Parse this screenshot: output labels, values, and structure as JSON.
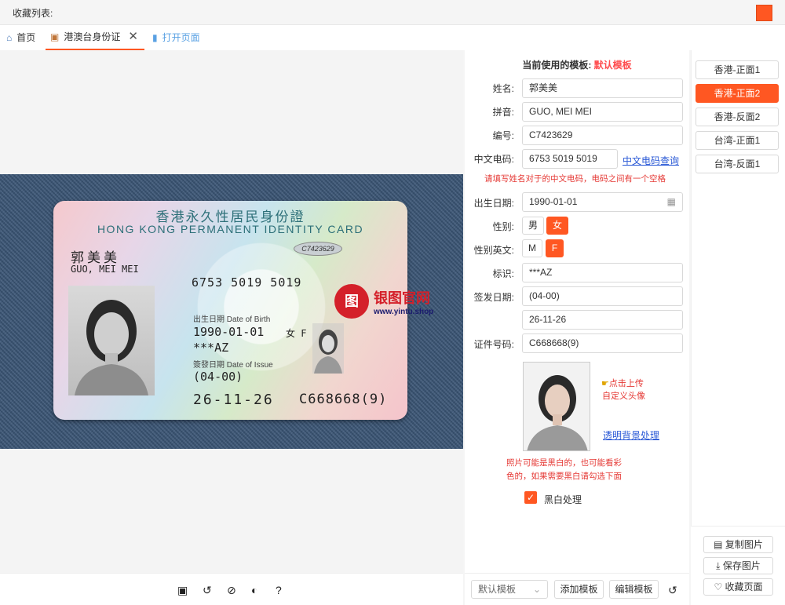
{
  "topbar": {
    "title": "收藏列表:",
    "accent": "#ff5722"
  },
  "tabs": [
    {
      "label": "首页",
      "icon": "home-icon"
    },
    {
      "label": "港澳台身份证",
      "icon": "id-card-icon"
    },
    {
      "label": "打开页面",
      "icon": "page-icon"
    }
  ],
  "card": {
    "title_zh": "香港永久性居民身份證",
    "title_en": "HONG KONG PERMANENT IDENTITY CARD",
    "chip": "C7423629",
    "name_zh": "郭美美",
    "name_en": "GUO, MEI MEI",
    "ccode": "6753 5019 5019",
    "dob_label": "出生日期 Date of Birth",
    "dob": "1990-01-01",
    "sex": "女 F",
    "mark": "***AZ",
    "issue_label": "簽發日期 Date of Issue",
    "issue1": "(04-00)",
    "issue2": "26-11-26",
    "id_no": "C668668(9)"
  },
  "watermark": {
    "logo": "图",
    "name": "银图官网",
    "url": "www.yintu.shop"
  },
  "form": {
    "header_label": "当前使用的模板:",
    "header_value": "默认模板",
    "name_label": "姓名:",
    "name": "郭美美",
    "pinyin_label": "拼音:",
    "pinyin": "GUO, MEI MEI",
    "no_label": "编号:",
    "no": "C7423629",
    "ccode_label": "中文电码:",
    "ccode": "6753 5019 5019",
    "ccode_link": "中文电码查询",
    "ccode_hint": "请填写姓名对于的中文电码，电码之间有一个空格",
    "dob_label": "出生日期:",
    "dob": "1990-01-01",
    "sex_label": "性别:",
    "sex_m": "男",
    "sex_f": "女",
    "sexen_label": "性别英文:",
    "sexen_m": "M",
    "sexen_f": "F",
    "mark_label": "标识:",
    "mark": "***AZ",
    "issue_label": "签发日期:",
    "issue1": "(04-00)",
    "issue2": "26-11-26",
    "idno_label": "证件号码:",
    "idno": "C668668(9)",
    "upload_line1": "点击上传",
    "upload_line2": "自定义头像",
    "transparent_link": "透明背景处理",
    "photo_hint1": "照片可能是黑白的，也可能看彩",
    "photo_hint2": "色的，如果需要黑白请勾选下面",
    "bw_label": "黑白处理"
  },
  "templates": [
    "香港-正面1",
    "香港-正面2",
    "香港-反面2",
    "台湾-正面1",
    "台湾-反面1"
  ],
  "actions": {
    "copy": "复制图片",
    "save": "保存图片",
    "fav": "收藏页面"
  },
  "bottom": {
    "select": "默认模板",
    "add": "添加模板",
    "edit": "编辑模板"
  }
}
